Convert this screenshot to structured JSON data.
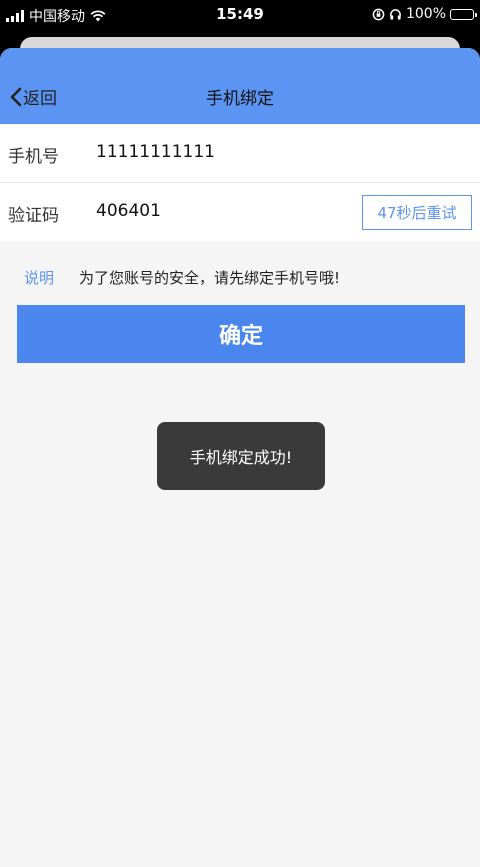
{
  "status_bar": {
    "carrier": "中国移动",
    "time": "15:49",
    "battery_percent": "100%",
    "icons": [
      "signal-icon",
      "wifi-icon",
      "rotation-lock-icon",
      "headphones-icon",
      "battery-charging-icon"
    ]
  },
  "nav": {
    "back_label": "返回",
    "title": "手机绑定",
    "bar_color": "#5b94f2"
  },
  "form": {
    "phone_label": "手机号",
    "phone_value": "11111111111",
    "code_label": "验证码",
    "code_value": "406401",
    "retry_label": "47秒后重试"
  },
  "note": {
    "tag": "说明",
    "text": "为了您账号的安全，请先绑定手机号哦!"
  },
  "confirm_label": "确定",
  "toast_text": "手机绑定成功!",
  "colors": {
    "accent": "#4a86ee",
    "toast_bg": "#3a3a3a"
  }
}
